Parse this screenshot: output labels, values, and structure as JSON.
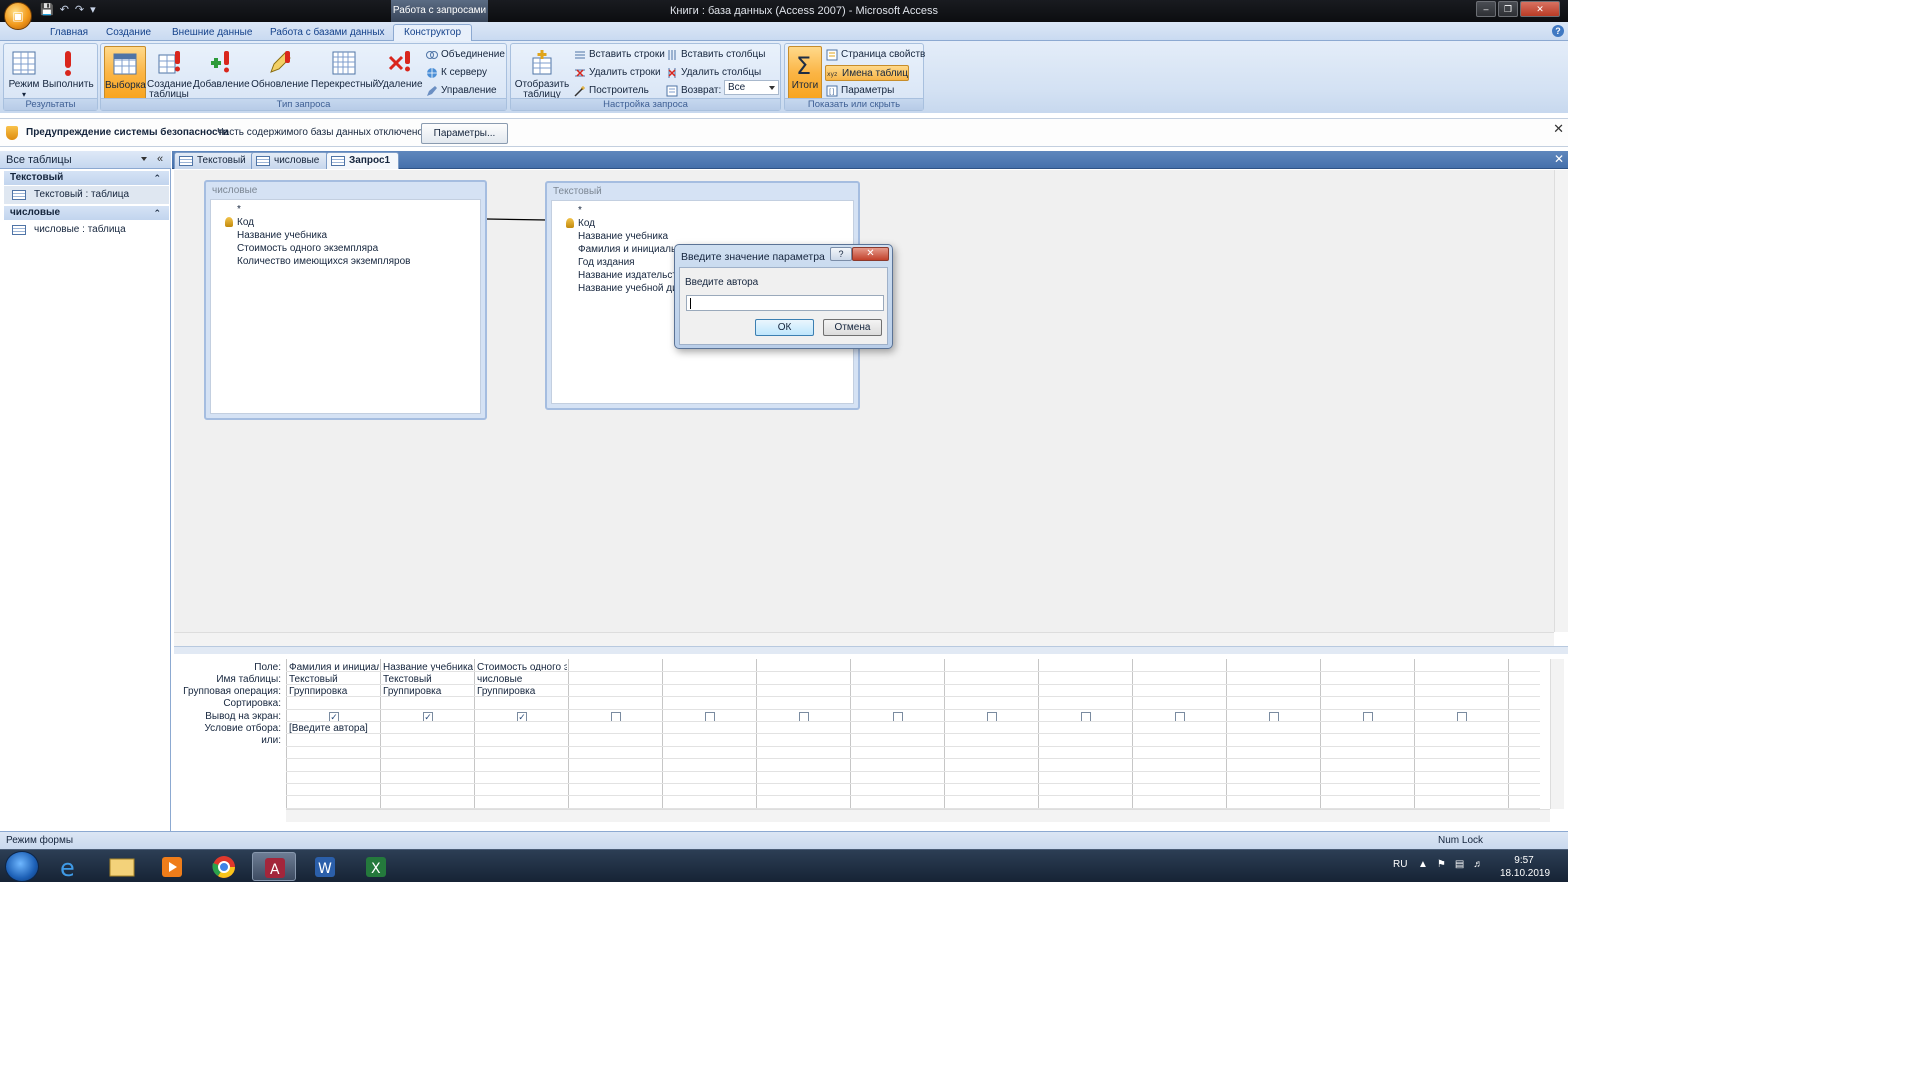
{
  "window": {
    "context_tab": "Работа с запросами",
    "title": "Книги : база данных (Access 2007) - Microsoft Access"
  },
  "ribbon_tabs": [
    "Главная",
    "Создание",
    "Внешние данные",
    "Работа с базами данных",
    "Конструктор"
  ],
  "ribbon": {
    "results": {
      "title": "Результаты",
      "mode": "Режим",
      "run": "Выполнить"
    },
    "query_type": {
      "title": "Тип запроса",
      "select": "Выборка",
      "make_table": "Создание таблицы",
      "append": "Добавление",
      "update": "Обновление",
      "crosstab": "Перекрестный",
      "delete": "Удаление",
      "union": "Объединение",
      "pass_through": "К серверу",
      "data_definition": "Управление"
    },
    "query_setup": {
      "title": "Настройка запроса",
      "show_table": "Отобразить таблицу",
      "insert_rows": "Вставить строки",
      "delete_rows": "Удалить строки",
      "builder": "Построитель",
      "insert_columns": "Вставить столбцы",
      "delete_columns": "Удалить столбцы",
      "return_label": "Возврат:",
      "return_value": "Все"
    },
    "show_hide": {
      "title": "Показать или скрыть",
      "totals": "Итоги",
      "property_sheet": "Страница свойств",
      "table_names": "Имена таблиц",
      "parameters": "Параметры"
    }
  },
  "security_bar": {
    "title": "Предупреждение системы безопасности",
    "message": "Часть содержимого базы данных отключено",
    "button": "Параметры..."
  },
  "nav_pane": {
    "header": "Все таблицы",
    "groups": [
      {
        "name": "Текстовый",
        "item": "Текстовый : таблица"
      },
      {
        "name": "числовые",
        "item": "числовые : таблица"
      }
    ]
  },
  "doc_tabs": [
    "Текстовый",
    "числовые",
    "Запрос1"
  ],
  "tables": {
    "numeric": {
      "title": "числовые",
      "fields": [
        "*",
        "Код",
        "Название учебника",
        "Стоимость одного экземпляра",
        "Количество имеющихся экземпляров"
      ]
    },
    "text": {
      "title": "Текстовый",
      "fields": [
        "*",
        "Код",
        "Название учебника",
        "Фамилия и инициалы",
        "Год издания",
        "Название  издательства",
        "Название учебной ди"
      ]
    }
  },
  "grid": {
    "row_labels": [
      "Поле:",
      "Имя таблицы:",
      "Групповая операция:",
      "Сортировка:",
      "Вывод на экран:",
      "Условие отбора:",
      "или:"
    ],
    "columns": [
      {
        "field": "Фамилия и инициалы",
        "table": "Текстовый",
        "total": "Группировка",
        "show": true,
        "criteria": "[Введите автора]"
      },
      {
        "field": "Название учебника",
        "table": "Текстовый",
        "total": "Группировка",
        "show": true,
        "criteria": ""
      },
      {
        "field": "Стоимость одного экземпляра",
        "table": "числовые",
        "total": "Группировка",
        "show": true,
        "criteria": ""
      }
    ],
    "empty_columns": 10
  },
  "dialog": {
    "title": "Введите значение параметра",
    "prompt": "Введите автора",
    "input_value": "",
    "ok": "ОК",
    "cancel": "Отмена"
  },
  "status": {
    "left": "Режим формы",
    "num_lock": "Num Lock"
  },
  "taskbar": {
    "lang": "RU",
    "time": "9:57",
    "date": "18.10.2019"
  }
}
